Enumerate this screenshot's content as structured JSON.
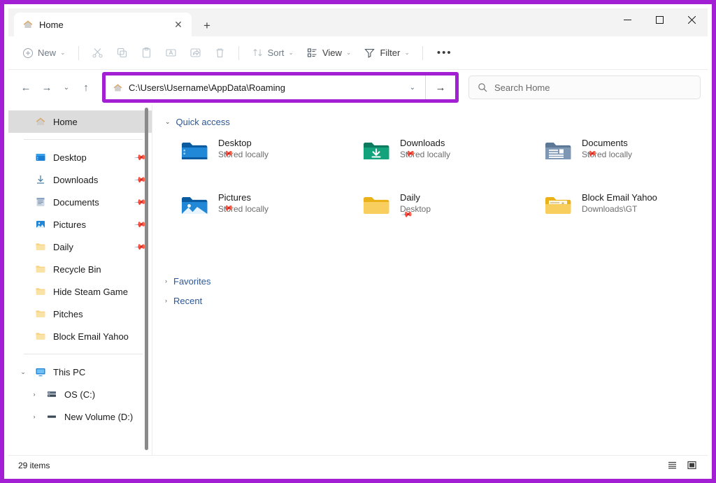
{
  "colors": {
    "highlight": "#a21fd4",
    "accent_blue": "#2b5797",
    "selected_bg": "#dcdcdc"
  },
  "window": {
    "tab_title": "Home",
    "tab_close_label": "✕",
    "new_tab_label": "+",
    "minimize_label": "–",
    "maximize_label": "□",
    "close_label": "✕"
  },
  "toolbar": {
    "new_label": "New",
    "new_chevron": "⌄",
    "cut_name": "Cut",
    "copy_name": "Copy",
    "paste_name": "Paste",
    "rename_name": "Rename",
    "share_name": "Share",
    "delete_name": "Delete",
    "sort_label": "Sort",
    "sort_chevron": "⌄",
    "view_label": "View",
    "view_chevron": "⌄",
    "filter_label": "Filter",
    "filter_chevron": "⌄",
    "overflow_label": "•••"
  },
  "navigation": {
    "back_label": "←",
    "forward_label": "→",
    "recent_label": "⌄",
    "up_label": "↑"
  },
  "address": {
    "path": "C:\\Users\\Username\\AppData\\Roaming",
    "dropdown_label": "⌄",
    "go_label": "→"
  },
  "search": {
    "placeholder": "Search Home"
  },
  "sidebar": {
    "home": {
      "label": "Home"
    },
    "quick_items": [
      {
        "label": "Desktop",
        "icon": "desktop-folder-icon",
        "pinned": true
      },
      {
        "label": "Downloads",
        "icon": "downloads-arrow-icon",
        "pinned": true
      },
      {
        "label": "Documents",
        "icon": "documents-folder-icon",
        "pinned": true
      },
      {
        "label": "Pictures",
        "icon": "pictures-folder-icon",
        "pinned": true
      },
      {
        "label": "Daily",
        "icon": "folder-icon",
        "pinned": true
      },
      {
        "label": "Recycle Bin",
        "icon": "folder-icon",
        "pinned": false
      },
      {
        "label": "Hide Steam Game",
        "icon": "folder-icon",
        "pinned": false
      },
      {
        "label": "Pitches",
        "icon": "folder-icon",
        "pinned": false
      },
      {
        "label": "Block Email Yahoo",
        "icon": "folder-icon",
        "pinned": false
      }
    ],
    "this_pc": {
      "label": "This PC",
      "chevron": "⌄"
    },
    "drives": [
      {
        "label": "OS (C:)",
        "chevron": "›"
      },
      {
        "label": "New Volume (D:)",
        "chevron": "›"
      }
    ],
    "pin_glyph": "📌"
  },
  "main": {
    "quick_access": {
      "label": "Quick access",
      "chevron": "⌄",
      "items": [
        {
          "name": "Desktop",
          "sub": "Stored locally",
          "icon": "desktop-folder-icon",
          "pinned": true
        },
        {
          "name": "Downloads",
          "sub": "Stored locally",
          "icon": "downloads-folder-icon",
          "pinned": true
        },
        {
          "name": "Documents",
          "sub": "Stored locally",
          "icon": "documents-folder-icon",
          "pinned": true
        },
        {
          "name": "Pictures",
          "sub": "Stored locally",
          "icon": "pictures-folder-icon",
          "pinned": true
        },
        {
          "name": "Daily",
          "sub": "Desktop",
          "icon": "folder-icon",
          "pinned": true
        },
        {
          "name": "Block Email Yahoo",
          "sub": "Downloads\\GT",
          "icon": "folder-contents-icon",
          "pinned": false
        }
      ]
    },
    "sections": [
      {
        "label": "Favorites",
        "chevron": "›"
      },
      {
        "label": "Recent",
        "chevron": "›"
      }
    ]
  },
  "status": {
    "item_count": "29 items",
    "details_view_name": "details-view",
    "large_icons_view_name": "large-icons-view"
  }
}
